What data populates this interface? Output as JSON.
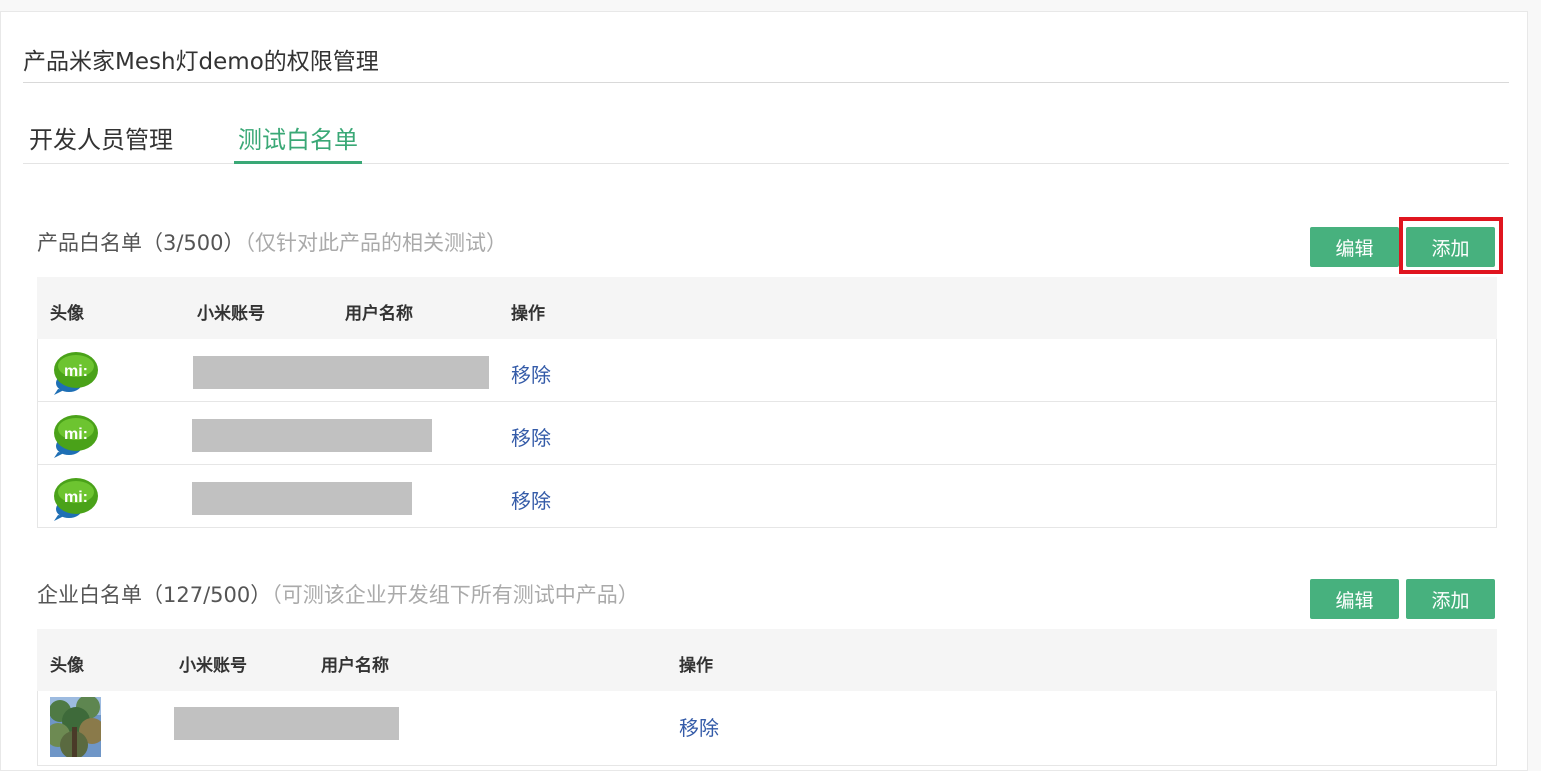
{
  "page": {
    "title": "产品米家Mesh灯demo的权限管理"
  },
  "tabs": [
    {
      "label": "开发人员管理",
      "active": false
    },
    {
      "label": "测试白名单",
      "active": true
    }
  ],
  "colors": {
    "accent": "#3aa876",
    "button": "#47b17e",
    "link": "#345ba8",
    "highlight": "#e0151f"
  },
  "product_whitelist": {
    "title": "产品白名单（3/500）",
    "note": "（仅针对此产品的相关测试）",
    "edit_label": "编辑",
    "add_label": "添加",
    "columns": [
      "头像",
      "小米账号",
      "用户名称",
      "操作"
    ],
    "rows": [
      {
        "avatar": "mi-chat-icon",
        "action": "移除"
      },
      {
        "avatar": "mi-chat-icon",
        "action": "移除"
      },
      {
        "avatar": "mi-chat-icon",
        "action": "移除"
      }
    ]
  },
  "enterprise_whitelist": {
    "title": "企业白名单（127/500）",
    "note": "（可测该企业开发组下所有测试中产品）",
    "edit_label": "编辑",
    "add_label": "添加",
    "columns": [
      "头像",
      "小米账号",
      "用户名称",
      "操作"
    ],
    "rows": [
      {
        "avatar": "tree-photo",
        "action": "移除"
      }
    ]
  }
}
